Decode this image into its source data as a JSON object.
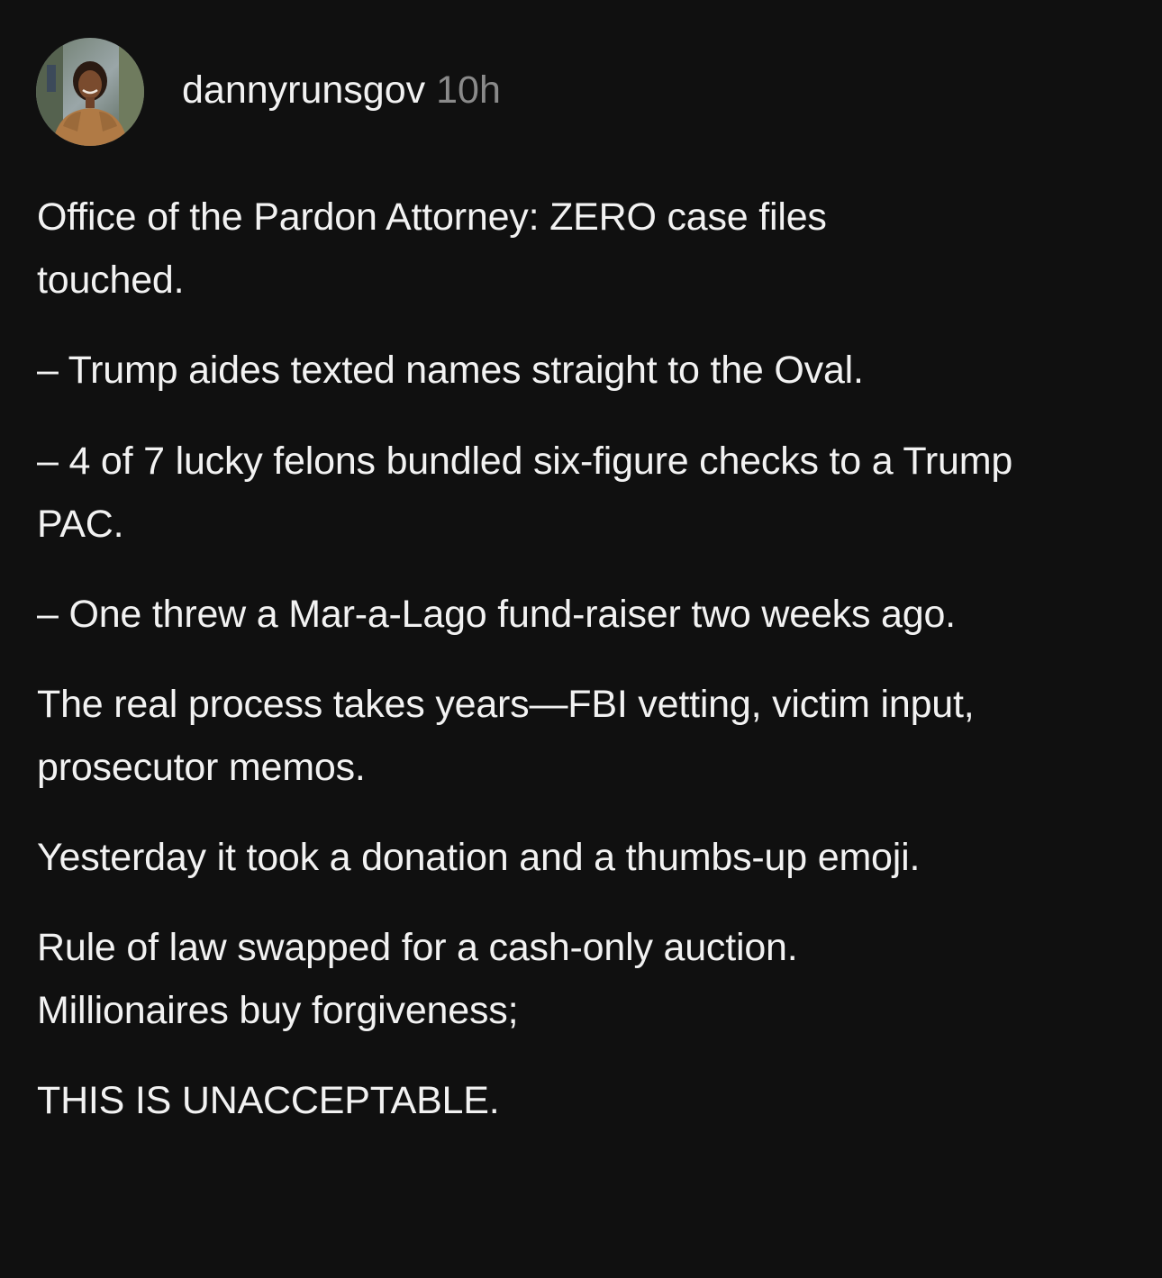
{
  "post": {
    "author": {
      "username": "dannyrunsgov",
      "timestamp": "10h",
      "avatar_icon": "profile-photo"
    },
    "body": {
      "paragraphs": [
        "Office of the Pardon Attorney: ZERO case files touched.",
        "– Trump aides texted names straight to the Oval.",
        "– 4 of 7 lucky felons bundled six-figure checks to a Trump PAC.",
        "– One threw a Mar-a-Lago fund-raiser two weeks ago.",
        "The real process takes years—FBI vetting, victim input, prosecutor memos.",
        "Yesterday it took a donation and a thumbs-up emoji.",
        "Rule of law swapped for a cash-only auction. Millionaires buy forgiveness;",
        "THIS IS UNACCEPTABLE."
      ]
    }
  },
  "colors": {
    "background": "#101010",
    "text": "#f2f2f2",
    "timestamp": "#8a8a8a"
  }
}
